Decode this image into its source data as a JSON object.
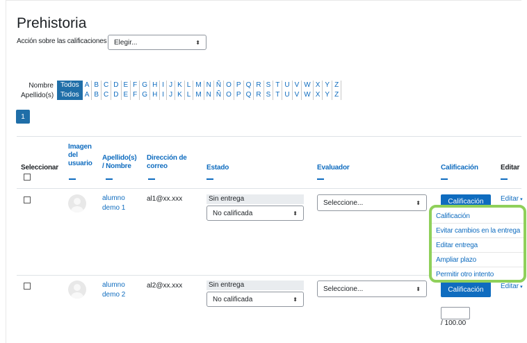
{
  "page": {
    "title": "Prehistoria"
  },
  "grading_action": {
    "label": "Acción sobre las calificaciones",
    "select_value": "Elegir..."
  },
  "filters": {
    "first_name": {
      "label": "Nombre",
      "all": "Todos"
    },
    "last_name": {
      "label": "Apellido(s)",
      "all": "Todos"
    },
    "letters": [
      "A",
      "B",
      "C",
      "D",
      "E",
      "F",
      "G",
      "H",
      "I",
      "J",
      "K",
      "L",
      "M",
      "N",
      "Ñ",
      "O",
      "P",
      "Q",
      "R",
      "S",
      "T",
      "U",
      "V",
      "W",
      "X",
      "Y",
      "Z"
    ]
  },
  "pagination": {
    "current_page": "1"
  },
  "table": {
    "headers": {
      "select": "Seleccionar",
      "image": [
        "Imagen",
        "del",
        "usuario"
      ],
      "name": [
        "Apellido(s)",
        "/ Nombre"
      ],
      "email": [
        "Dirección de",
        "correo"
      ],
      "status": "Estado",
      "grader": "Evaluador",
      "grade": "Calificación",
      "edit": "Editar"
    },
    "rows": [
      {
        "name": [
          "alumno",
          "demo 1"
        ],
        "email": "al1@xx.xxx",
        "status": "Sin entrega",
        "grading_status": "No calificada",
        "grader_value": "Seleccione...",
        "grade_button": "Calificación",
        "edit_label": "Editar"
      },
      {
        "name": [
          "alumno",
          "demo 2"
        ],
        "email": "al2@xx.xxx",
        "status": "Sin entrega",
        "grading_status": "No calificada",
        "grader_value": "Seleccione...",
        "grade_button": "Calificación",
        "edit_label": "Editar",
        "grade_max": "/ 100.00"
      }
    ]
  },
  "edit_menu": {
    "items": [
      "Calificación",
      "Evitar cambios en la entrega",
      "Editar entrega",
      "Ampliar plazo",
      "Permitir otro intento"
    ],
    "highlight_color": "#8fd05a"
  },
  "icons": {
    "sort": "sort-arrows-icon",
    "caret": "caret-down-icon",
    "avatar": "default-user-avatar-icon"
  }
}
